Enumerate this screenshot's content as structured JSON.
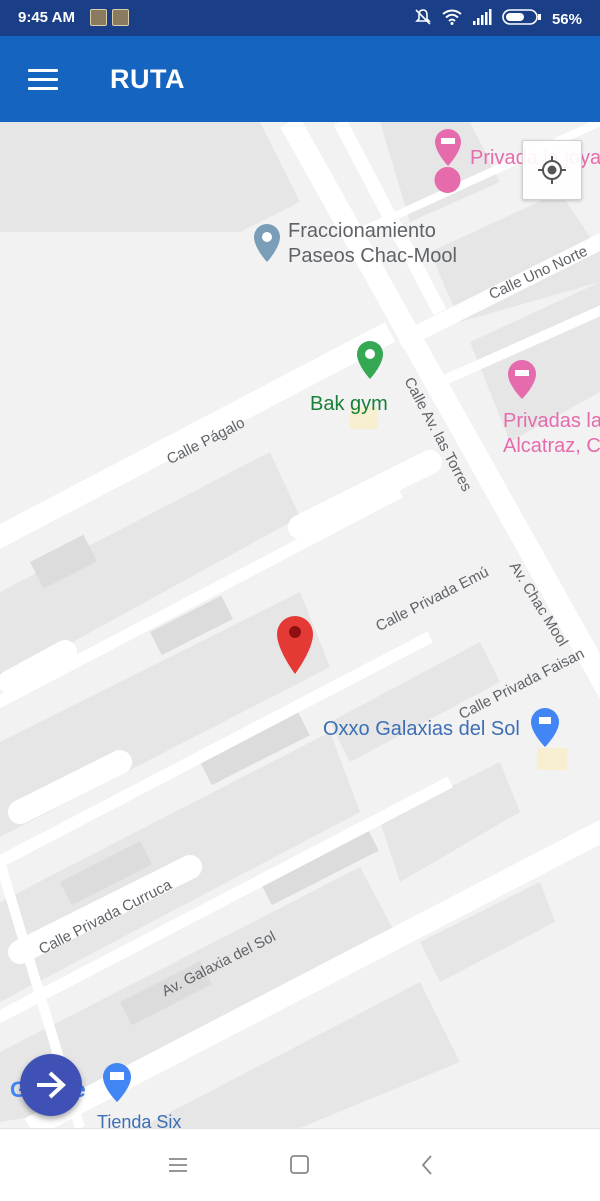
{
  "status_bar": {
    "time": "9:45 AM",
    "battery": "56%",
    "icons": [
      "mute-icon",
      "wifi-icon",
      "signal-icon",
      "battery-icon"
    ]
  },
  "app_bar": {
    "title": "RUTA",
    "menu_icon": "hamburger-menu-icon"
  },
  "map": {
    "streets": [
      "Calle Uno Norte",
      "Calle Págalo",
      "Calle Av. las Torres",
      "Av. Chac Mool",
      "Calle Privada Emú",
      "Calle Privada Faisan",
      "Calle Privada Curruca",
      "Av. Galaxia del Sol"
    ],
    "pois": [
      {
        "name": "Privada la joya",
        "color": "#e56bad",
        "icon": "hotel-icon"
      },
      {
        "name_line1": "Fraccionamiento",
        "name_line2": "Paseos Chac-Mool",
        "color": "#5f6368",
        "icon": "place-pin-icon"
      },
      {
        "name": "Bak gym",
        "color": "#188038",
        "icon": "place-pin-icon"
      },
      {
        "name_line1": "Privadas la",
        "name_line2": "Alcatraz, C",
        "color": "#e56bad",
        "icon": "hotel-icon"
      },
      {
        "name": "Oxxo Galaxias del Sol",
        "color": "#3c6fb4",
        "icon": "shopping-cart-icon"
      },
      {
        "name": "Tienda Six",
        "color": "#3c6fb4",
        "icon": "store-icon"
      }
    ],
    "attribution": "Google",
    "colors": {
      "marker": "#e53935",
      "street": "#ffffff",
      "block": "#e6e6e6",
      "land": "#f2f2f2"
    }
  },
  "controls": {
    "locate_icon": "my-location-icon",
    "fab_icon": "arrow-right-icon"
  },
  "nav_bar": {
    "icons": [
      "recents-icon",
      "home-icon",
      "back-icon"
    ]
  }
}
